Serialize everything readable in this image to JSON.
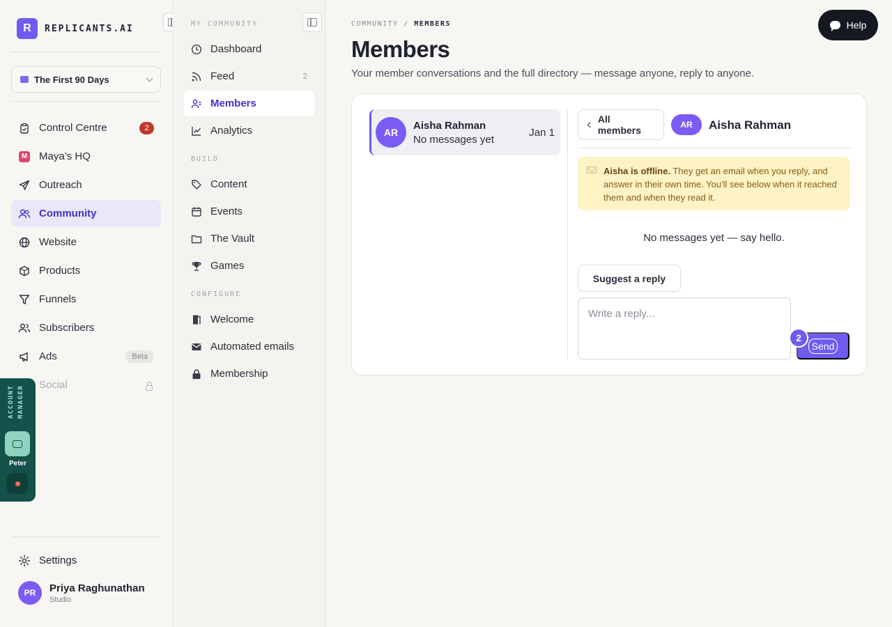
{
  "brand": {
    "mark": "R",
    "name": "REPLICANTS.AI"
  },
  "workspace": {
    "label": "The First 90 Days"
  },
  "sidebar": {
    "items": [
      {
        "label": "Control Centre",
        "icon": "clipboard-icon",
        "badge": "2"
      },
      {
        "label": "Maya’s HQ",
        "icon": "maya-icon",
        "icon_text": "M"
      },
      {
        "label": "Outreach",
        "icon": "send-icon"
      },
      {
        "label": "Community",
        "icon": "people-icon",
        "active": true
      },
      {
        "label": "Website",
        "icon": "globe-icon"
      },
      {
        "label": "Products",
        "icon": "box-icon"
      },
      {
        "label": "Funnels",
        "icon": "funnel-icon"
      },
      {
        "label": "Subscribers",
        "icon": "users-icon"
      },
      {
        "label": "Ads",
        "icon": "megaphone-icon",
        "badge": "Beta"
      },
      {
        "label": "Social",
        "icon": "share-icon",
        "locked": true
      }
    ],
    "settings_label": "Settings"
  },
  "account_manager": {
    "label": "ACCOUNT MANAGER",
    "name": "Peter"
  },
  "user": {
    "initials": "PR",
    "name": "Priya Raghunathan",
    "role": "Studio"
  },
  "subnav": {
    "sections": {
      "my_community": "MY COMMUNITY",
      "build": "BUILD",
      "configure": "CONFIGURE"
    },
    "my_community": [
      {
        "label": "Dashboard",
        "icon": "clock-icon"
      },
      {
        "label": "Feed",
        "icon": "rss-icon",
        "count": "2"
      },
      {
        "label": "Members",
        "icon": "member-icon",
        "active": true
      },
      {
        "label": "Analytics",
        "icon": "chart-icon"
      }
    ],
    "build": [
      {
        "label": "Content",
        "icon": "tag-icon"
      },
      {
        "label": "Events",
        "icon": "calendar-icon"
      },
      {
        "label": "The Vault",
        "icon": "folder-icon"
      },
      {
        "label": "Games",
        "icon": "trophy-icon"
      }
    ],
    "configure": [
      {
        "label": "Welcome",
        "icon": "door-icon"
      },
      {
        "label": "Automated emails",
        "icon": "envelope-icon"
      },
      {
        "label": "Membership",
        "icon": "lock-icon"
      }
    ]
  },
  "main": {
    "breadcrumb": {
      "parent": "COMMUNITY",
      "separator": "/",
      "current": "MEMBERS"
    },
    "title": "Members",
    "subtitle": "Your member conversations and the full directory — message anyone, reply to anyone.",
    "help_label": "Help"
  },
  "conversations": [
    {
      "initials": "AR",
      "name": "Aisha Rahman",
      "preview": "No messages yet",
      "date": "Jan 1"
    }
  ],
  "thread": {
    "back_label": "All members",
    "initials": "AR",
    "name": "Aisha Rahman",
    "banner_strong": "Aisha is offline.",
    "banner_text": " They get an email when you reply, and answer in their own time. You'll see below when it reached them and when they read it.",
    "empty": "No messages yet — say hello.",
    "suggest_label": "Suggest a reply",
    "reply_placeholder": "Write a reply...",
    "send_label": "Send",
    "send_badge": "2"
  },
  "colors": {
    "accent": "#6e5bf0",
    "active_text": "#4133c7",
    "badge_red": "#c0392b",
    "account_bg": "#13514a",
    "banner_bg": "#fdf3c5"
  }
}
